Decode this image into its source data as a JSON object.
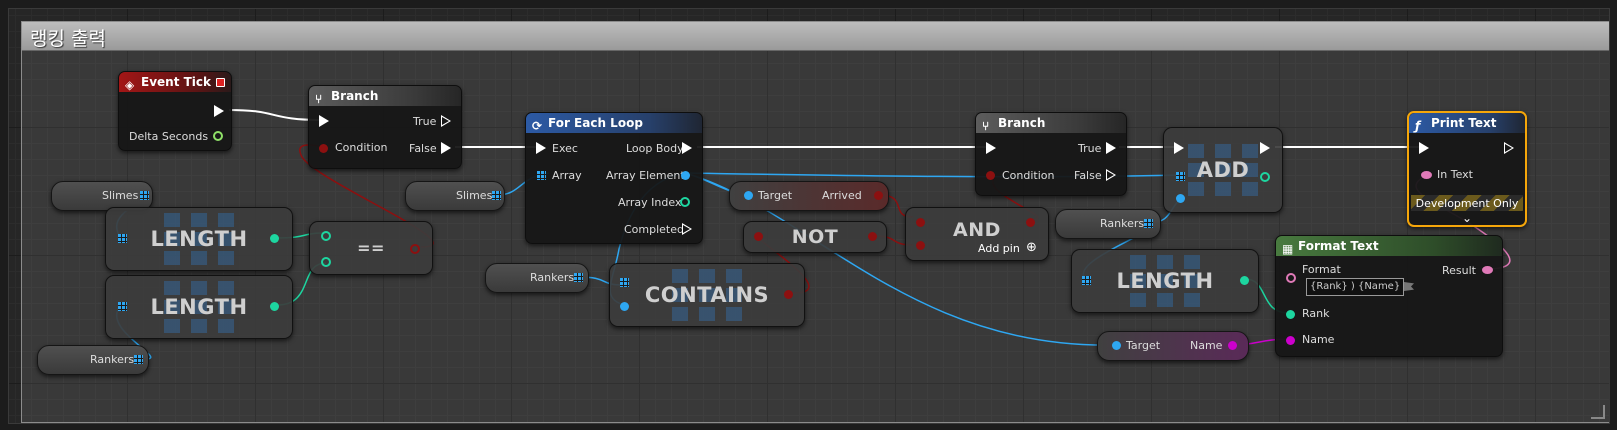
{
  "comment": {
    "title": "랭킹 출력"
  },
  "event_tick": {
    "title": "Event Tick",
    "output_label": "Delta Seconds"
  },
  "branch1": {
    "title": "Branch",
    "condition_label": "Condition",
    "true_label": "True",
    "false_label": "False"
  },
  "branch2": {
    "title": "Branch",
    "condition_label": "Condition",
    "true_label": "True",
    "false_label": "False"
  },
  "foreach": {
    "title": "For Each Loop",
    "exec_label": "Exec",
    "array_label": "Array",
    "loop_body_label": "Loop Body",
    "element_label": "Array Element",
    "index_label": "Array Index",
    "completed_label": "Completed"
  },
  "print_text": {
    "title": "Print Text",
    "in_text_label": "In Text",
    "dev_label": "Development Only"
  },
  "format_text": {
    "title": "Format Text",
    "format_label": "Format",
    "format_value": "{Rank} ) {Name}",
    "result_label": "Result",
    "rank_label": "Rank",
    "name_label": "Name"
  },
  "vars": {
    "slimes": "Slimes",
    "rankers": "Rankers"
  },
  "compact": {
    "length": "LENGTH",
    "equals": "==",
    "contains": "CONTAINS",
    "not": "NOT",
    "and": "AND",
    "add": "ADD",
    "add_pin": "Add pin"
  },
  "getters": {
    "target": "Target",
    "arrived": "Arrived",
    "name": "Name"
  },
  "colors": {
    "exec": "#ffffff",
    "bool": "#8c1010",
    "int": "#1dd6a0",
    "object": "#2ea7f2",
    "text": "#e07ab8",
    "name": "#cc00cc",
    "selection": "#f5a60a"
  }
}
